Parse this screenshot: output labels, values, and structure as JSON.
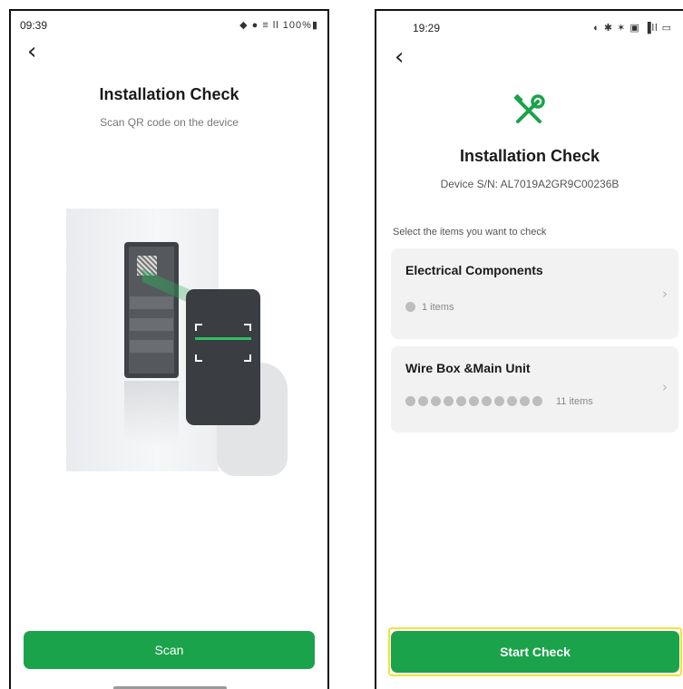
{
  "left_screen": {
    "status_time": "09:39",
    "status_icons": " ◆ ● ≡ ll 100%▮",
    "back_glyph": "‹",
    "title": "Installation Check",
    "subtitle": "Scan QR code on the device",
    "scan_label": "Scan"
  },
  "right_screen": {
    "status_time": "19:29",
    "status_icons": "◐ ✱ ✶ ▣ ▐ll ▭",
    "back_glyph": "‹",
    "tool_icon": "wrench-screwdriver-icon",
    "title": "Installation Check",
    "device_sn": "Device S/N: AL7019A2GR9C00236B",
    "section_label": "Select the items you want to check",
    "cards": [
      {
        "title": "Electrical Components",
        "dot_count": 1,
        "count_text": "1 items"
      },
      {
        "title": "Wire Box &Main Unit",
        "dot_count": 11,
        "count_text": "11 items"
      }
    ],
    "chevron": "›",
    "start_label": "Start Check"
  },
  "colors": {
    "accent": "#1aa34a",
    "highlight": "#f2e236"
  }
}
